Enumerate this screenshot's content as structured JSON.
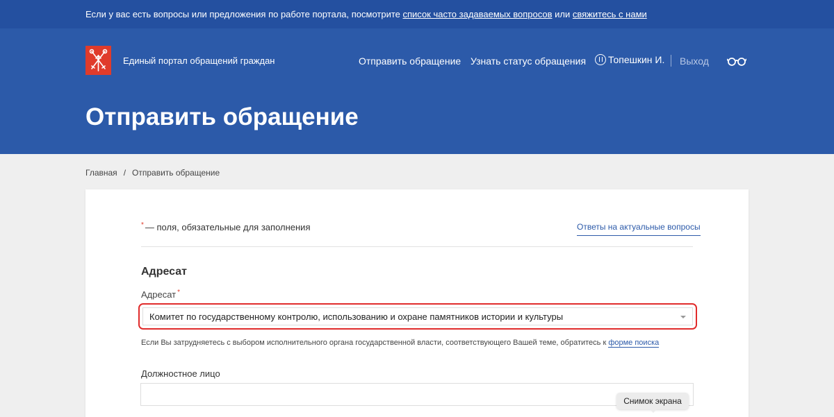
{
  "topbar": {
    "text_before": "Если у вас есть вопросы или предложения по работе портала, посмотрите ",
    "faq_link": "список часто задаваемых вопросов",
    "text_middle": " или ",
    "contact_link": "свяжитесь с нами"
  },
  "header": {
    "portal_name": "Единый портал обращений граждан",
    "nav_send": "Отправить обращение",
    "nav_status": "Узнать статус обращения",
    "user_name": "Топешкин И.",
    "logout": "Выход",
    "logo_icon": "coat-of-arms-icon",
    "accessibility_icon": "glasses-icon"
  },
  "page_title": "Отправить обращение",
  "breadcrumb": {
    "home": "Главная",
    "separator": "/",
    "current": "Отправить обращение"
  },
  "form": {
    "required_star": "*",
    "required_note": "— поля, обязательные для заполнения",
    "faq_answers_link": "Ответы на актуальные вопросы",
    "section_title": "Адресат",
    "addressee_label": "Адресат",
    "addressee_value": "Комитет по государственному контролю, использованию и охране памятников истории и культуры",
    "hint_text": "Если Вы затрудняетесь с выбором исполнительного органа государственной власти, соответствующего Вашей теме, обратитесь к ",
    "hint_link": "форме поиска",
    "official_label": "Должностное лицо",
    "official_value": ""
  },
  "tooltip": "Снимок экрана",
  "colors": {
    "topbar": "#2450a0",
    "header": "#2c5aa9",
    "logo": "#e03b2b",
    "highlight": "#e02b2b",
    "link": "#2c5aa9"
  }
}
